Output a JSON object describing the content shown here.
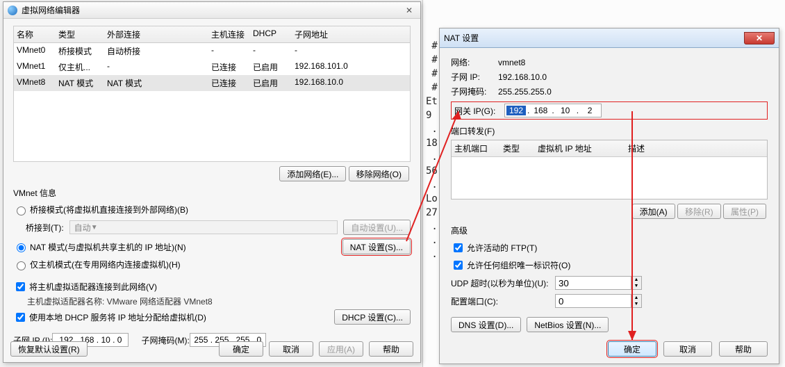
{
  "left": {
    "title": "虚拟网络编辑器",
    "columns": [
      "名称",
      "类型",
      "外部连接",
      "主机连接",
      "DHCP",
      "子网地址"
    ],
    "rows": [
      {
        "name": "VMnet0",
        "type": "桥接模式",
        "ext": "自动桥接",
        "host": "-",
        "dhcp": "-",
        "subnet": "-"
      },
      {
        "name": "VMnet1",
        "type": "仅主机...",
        "ext": "-",
        "host": "已连接",
        "dhcp": "已启用",
        "subnet": "192.168.101.0"
      },
      {
        "name": "VMnet8",
        "type": "NAT 模式",
        "ext": "NAT 模式",
        "host": "已连接",
        "dhcp": "已启用",
        "subnet": "192.168.10.0"
      }
    ],
    "add_net": "添加网络(E)...",
    "remove_net": "移除网络(O)",
    "vmnet_info": "VMnet 信息",
    "mode_bridge": "桥接模式(将虚拟机直接连接到外部网络)(B)",
    "bridge_to": "桥接到(T):",
    "bridge_sel": "自动",
    "auto_set": "自动设置(U)...",
    "mode_nat": "NAT 模式(与虚拟机共享主机的 IP 地址)(N)",
    "nat_set": "NAT 设置(S)...",
    "mode_host": "仅主机模式(在专用网络内连接虚拟机)(H)",
    "chk_connect": "将主机虚拟适配器连接到此网络(V)",
    "adapter_name": "主机虚拟适配器名称: VMware 网络适配器 VMnet8",
    "chk_dhcp": "使用本地 DHCP 服务将 IP 地址分配给虚拟机(D)",
    "dhcp_set": "DHCP 设置(C)...",
    "subnet_ip": "子网 IP (I):",
    "subnet_ip_val": "192 . 168 . 10 . 0",
    "subnet_mask": "子网掩码(M):",
    "subnet_mask_val": "255 . 255 . 255 . 0",
    "restore": "恢复默认设置(R)",
    "ok": "确定",
    "cancel": "取消",
    "apply": "应用(A)",
    "help": "帮助"
  },
  "right": {
    "title": "NAT 设置",
    "net_lbl": "网络:",
    "net_val": "vmnet8",
    "subip_lbl": "子网 IP:",
    "subip_val": "192.168.10.0",
    "submask_lbl": "子网掩码:",
    "submask_val": "255.255.255.0",
    "gateway_lbl": "网关 IP(G):",
    "gateway_oct": [
      "192",
      "168",
      "10",
      "2"
    ],
    "pf_title": "端口转发(F)",
    "pf_cols": [
      "主机端口",
      "类型",
      "虚拟机 IP 地址",
      "描述"
    ],
    "add": "添加(A)",
    "remove": "移除(R)",
    "prop": "属性(P)",
    "advanced": "高级",
    "allow_ftp": "允许活动的 FTP(T)",
    "allow_org": "允许任何组织唯一标识符(O)",
    "udp_lbl": "UDP 超时(以秒为单位)(U):",
    "udp_val": "30",
    "cfg_port_lbl": "配置端口(C):",
    "cfg_port_val": "0",
    "dns_set": "DNS 设置(D)...",
    "netbios_set": "NetBios 设置(N)...",
    "ok": "确定",
    "cancel": "取消",
    "help": "帮助"
  }
}
